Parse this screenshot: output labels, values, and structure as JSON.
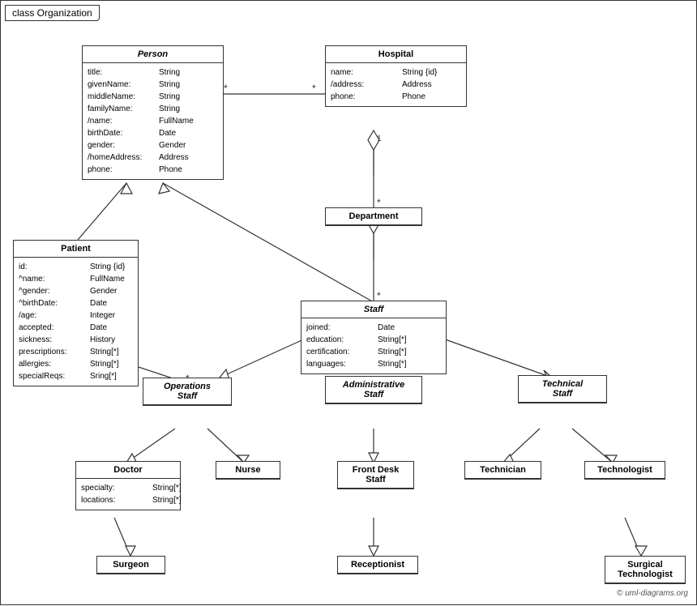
{
  "title": "class Organization",
  "classes": {
    "person": {
      "name": "Person",
      "italic": true,
      "attrs": [
        {
          "name": "title:",
          "type": "String"
        },
        {
          "name": "givenName:",
          "type": "String"
        },
        {
          "name": "middleName:",
          "type": "String"
        },
        {
          "name": "familyName:",
          "type": "String"
        },
        {
          "name": "/name:",
          "type": "FullName"
        },
        {
          "name": "birthDate:",
          "type": "Date"
        },
        {
          "name": "gender:",
          "type": "Gender"
        },
        {
          "name": "/homeAddress:",
          "type": "Address"
        },
        {
          "name": "phone:",
          "type": "Phone"
        }
      ]
    },
    "hospital": {
      "name": "Hospital",
      "italic": false,
      "attrs": [
        {
          "name": "name:",
          "type": "String {id}"
        },
        {
          "name": "/address:",
          "type": "Address"
        },
        {
          "name": "phone:",
          "type": "Phone"
        }
      ]
    },
    "department": {
      "name": "Department",
      "italic": false,
      "attrs": []
    },
    "staff": {
      "name": "Staff",
      "italic": true,
      "attrs": [
        {
          "name": "joined:",
          "type": "Date"
        },
        {
          "name": "education:",
          "type": "String[*]"
        },
        {
          "name": "certification:",
          "type": "String[*]"
        },
        {
          "name": "languages:",
          "type": "String[*]"
        }
      ]
    },
    "patient": {
      "name": "Patient",
      "italic": false,
      "attrs": [
        {
          "name": "id:",
          "type": "String {id}"
        },
        {
          "name": "^name:",
          "type": "FullName"
        },
        {
          "name": "^gender:",
          "type": "Gender"
        },
        {
          "name": "^birthDate:",
          "type": "Date"
        },
        {
          "name": "/age:",
          "type": "Integer"
        },
        {
          "name": "accepted:",
          "type": "Date"
        },
        {
          "name": "sickness:",
          "type": "History"
        },
        {
          "name": "prescriptions:",
          "type": "String[*]"
        },
        {
          "name": "allergies:",
          "type": "String[*]"
        },
        {
          "name": "specialReqs:",
          "type": "Sring[*]"
        }
      ]
    },
    "operations_staff": {
      "name": "Operations Staff",
      "italic": true
    },
    "administrative_staff": {
      "name": "Administrative Staff",
      "italic": true
    },
    "technical_staff": {
      "name": "Technical Staff",
      "italic": true
    },
    "doctor": {
      "name": "Doctor",
      "italic": false,
      "attrs": [
        {
          "name": "specialty:",
          "type": "String[*]"
        },
        {
          "name": "locations:",
          "type": "String[*]"
        }
      ]
    },
    "nurse": {
      "name": "Nurse",
      "italic": false,
      "attrs": []
    },
    "front_desk_staff": {
      "name": "Front Desk Staff",
      "italic": false,
      "attrs": []
    },
    "technician": {
      "name": "Technician",
      "italic": false,
      "attrs": []
    },
    "technologist": {
      "name": "Technologist",
      "italic": false,
      "attrs": []
    },
    "surgeon": {
      "name": "Surgeon",
      "italic": false,
      "attrs": []
    },
    "receptionist": {
      "name": "Receptionist",
      "italic": false,
      "attrs": []
    },
    "surgical_technologist": {
      "name": "Surgical Technologist",
      "italic": false,
      "attrs": []
    }
  },
  "copyright": "© uml-diagrams.org"
}
